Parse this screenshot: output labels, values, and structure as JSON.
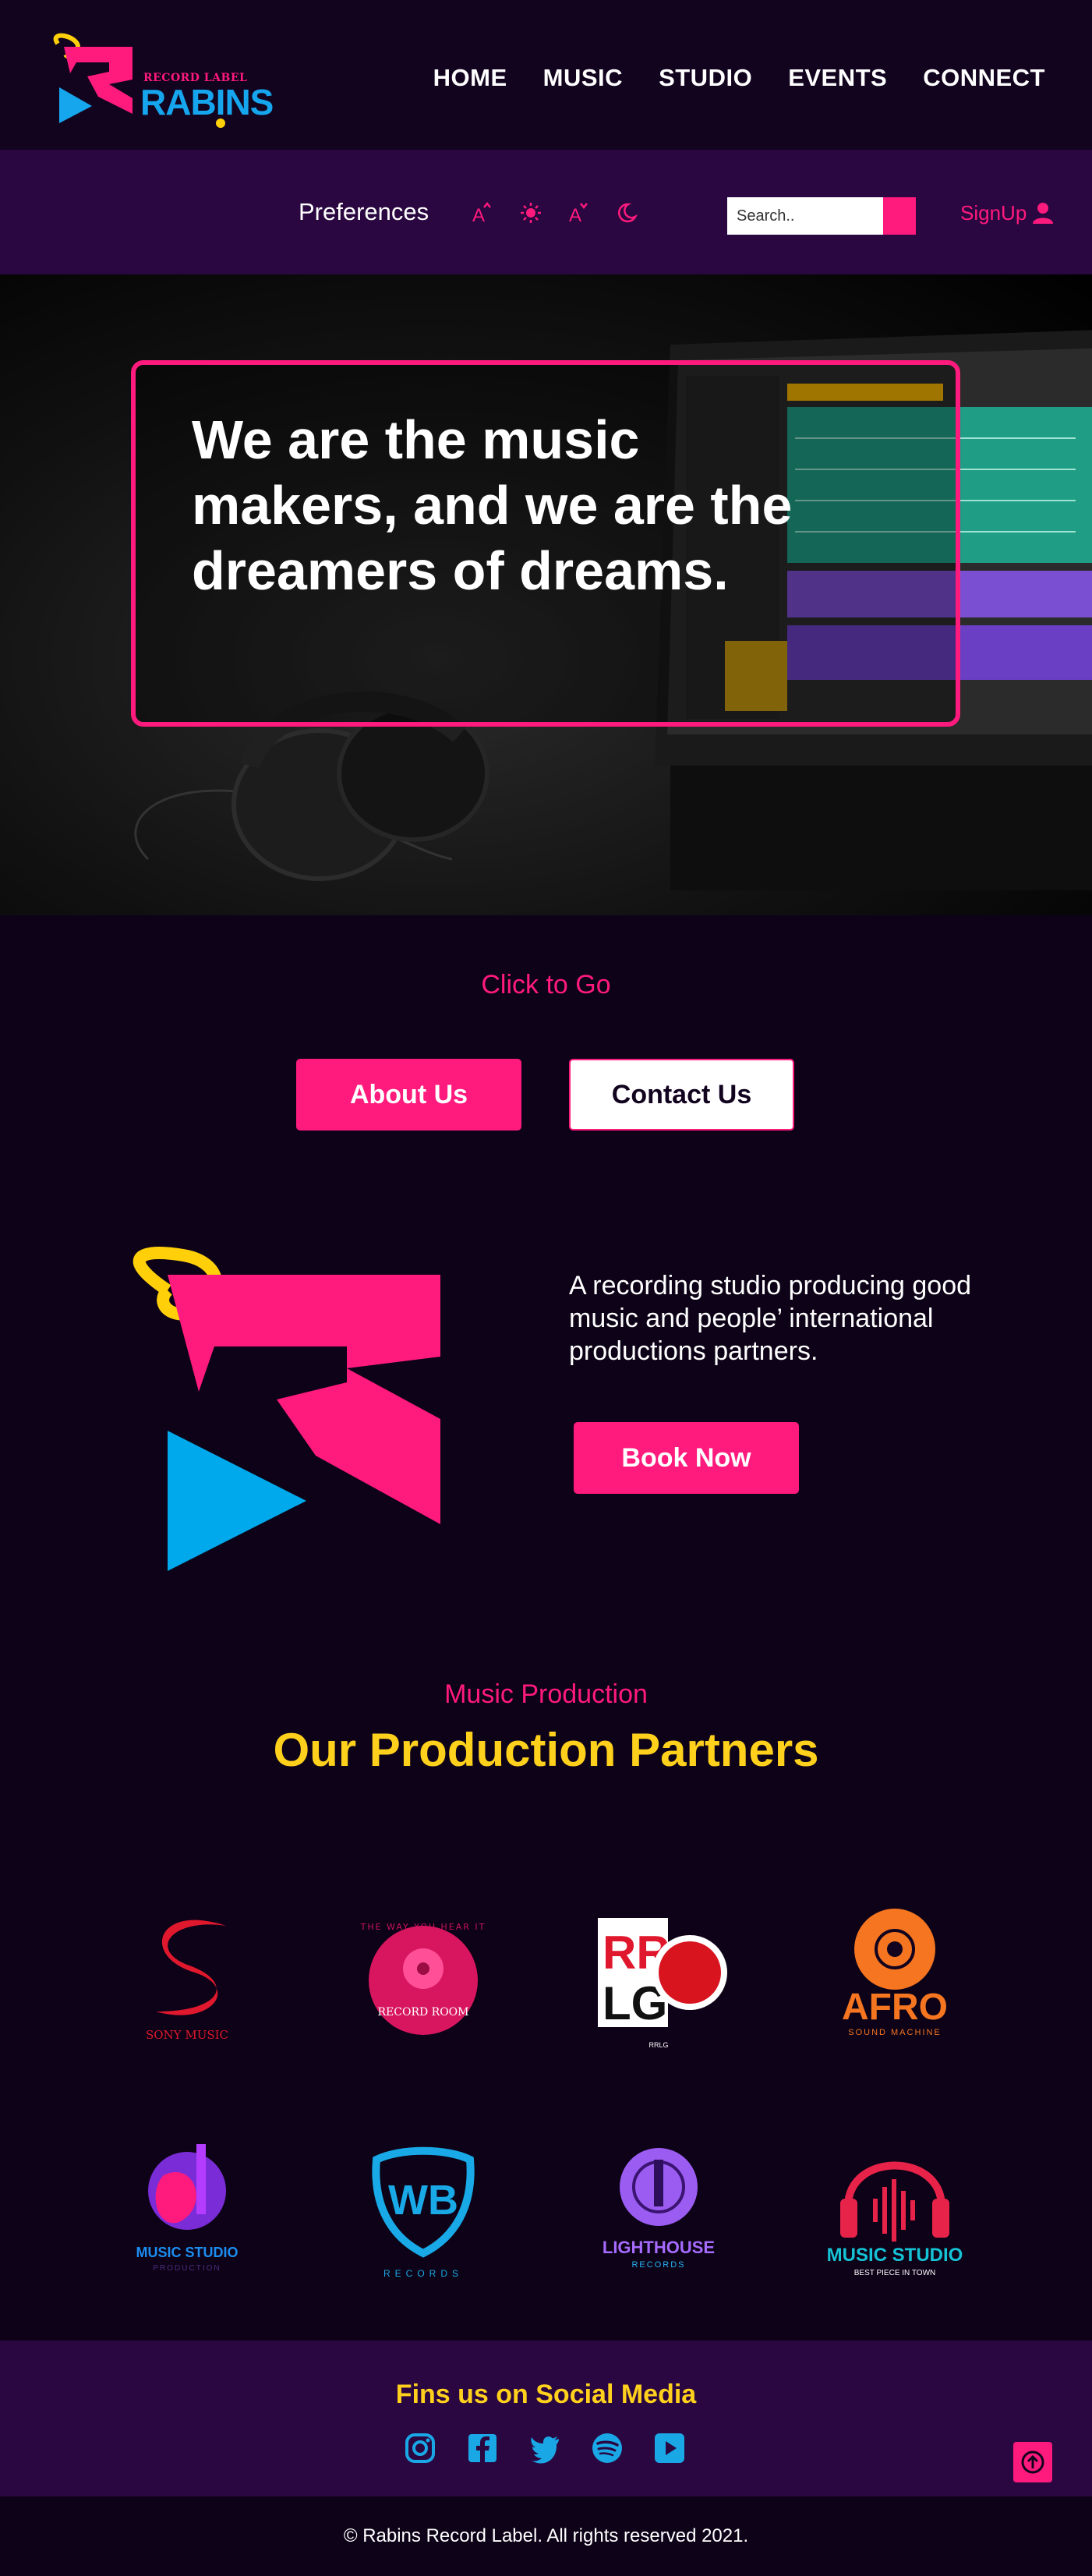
{
  "brand": {
    "tagline": "RECORD LABEL",
    "name": "RABINS",
    "colors": {
      "pink": "#ff1a7d",
      "blue": "#16a6ee",
      "yellow": "#ffd11c",
      "purple": "#2a0740",
      "dark": "#0d0217"
    }
  },
  "nav": {
    "items": [
      {
        "label": "HOME"
      },
      {
        "label": "MUSIC"
      },
      {
        "label": "STUDIO"
      },
      {
        "label": "EVENTS"
      },
      {
        "label": "CONNECT"
      }
    ]
  },
  "preferences": {
    "label": "Preferences",
    "icons": [
      "font-increase-icon",
      "brightness-icon",
      "font-decrease-icon",
      "dark-mode-icon"
    ],
    "search_placeholder": "Search..",
    "signup_label": "SignUp"
  },
  "hero": {
    "headline": "We are the music makers, and we are the dreamers of dreams."
  },
  "cta": {
    "heading": "Click to Go",
    "about_label": "About Us",
    "contact_label": "Contact Us"
  },
  "about": {
    "description": "A recording studio producing good music and people’ international productions partners.",
    "book_label": "Book Now"
  },
  "partners": {
    "subtitle": "Music Production",
    "title": "Our Production Partners",
    "logos": [
      {
        "name": "SONY MUSIC"
      },
      {
        "name": "RECORD ROOM",
        "tagline": "THE WAY YOU HEAR IT"
      },
      {
        "name": "RRLG"
      },
      {
        "name": "AFRO",
        "tagline": "SOUND MACHINE"
      },
      {
        "name": "MUSIC STUDIO",
        "tagline": "PRODUCTION"
      },
      {
        "name": "WB",
        "tagline": "RECORDS"
      },
      {
        "name": "LIGHTHOUSE",
        "tagline": "RECORDS"
      },
      {
        "name": "MUSIC STUDIO",
        "tagline": "BEST PIECE IN TOWN"
      }
    ]
  },
  "social": {
    "title": "Fins us on Social Media",
    "icons": [
      "instagram-icon",
      "facebook-icon",
      "twitter-icon",
      "spotify-icon",
      "youtube-icon"
    ]
  },
  "footer": {
    "copyright": "© Rabins Record Label. All rights reserved 2021."
  }
}
